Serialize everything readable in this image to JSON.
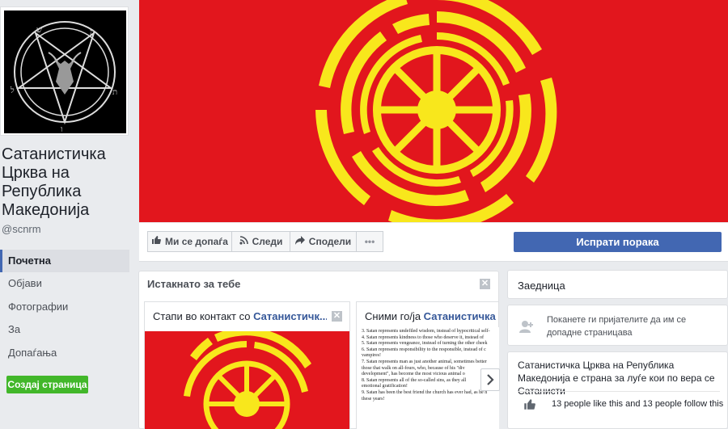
{
  "sidebar": {
    "page_name": "Сатанистичка Црква на Република Македонија",
    "handle": "@scnrm",
    "nav_items": [
      {
        "label": "Почетна",
        "active": true
      },
      {
        "label": "Објави",
        "active": false
      },
      {
        "label": "Фотографии",
        "active": false
      },
      {
        "label": "За",
        "active": false
      },
      {
        "label": "Допаѓања",
        "active": false
      }
    ],
    "create_page_label": "Создај страница"
  },
  "actions": {
    "like_label": "Ми се допаѓа",
    "follow_label": "Следи",
    "share_label": "Сподели",
    "more_label": "•••",
    "send_message_label": "Испрати порака"
  },
  "featured": {
    "title": "Истакнато за тебе",
    "card1": {
      "prefix": "Стапи во контакт со ",
      "bold": "Сатанистичк..."
    },
    "card2": {
      "prefix": "Сними го/ја ",
      "bold": "Сатанистичка Ц"
    },
    "doc_lines": [
      "3. Satan represents undefiled wisdom, instead of hypocritical self-",
      "4. Satan represents kindness to those who deserve it, instead of",
      "5. Satan represents vengeance, instead of turning the other cheek",
      "6. Satan represents responsibility to the responsible, instead of c",
      "   vampires!",
      "7. Satan represents man as just another animal, sometimes better",
      "   those that walk on all-fours, who, because of his \"div",
      "   development\", has become the most vicious animal o",
      "8. Satan represents all of the so-called sins, as they all",
      "   emotional gratification!",
      "9. Satan has been the best friend the church has ever had, as he h",
      "   these years!"
    ]
  },
  "right": {
    "community_title": "Заедница",
    "invite_text": "Поканете ги пријателите да им се допадне страницава",
    "about_text": "Сатанистичка Црква на Република Македонија е страна за луѓе кои по вера се Сатанисти",
    "likes_text": "13 people like this and 13 people follow this"
  },
  "colors": {
    "flag_red": "#e2161d",
    "flag_yellow": "#f8e71c",
    "facebook_blue": "#4267b2",
    "create_green": "#42b72a"
  }
}
